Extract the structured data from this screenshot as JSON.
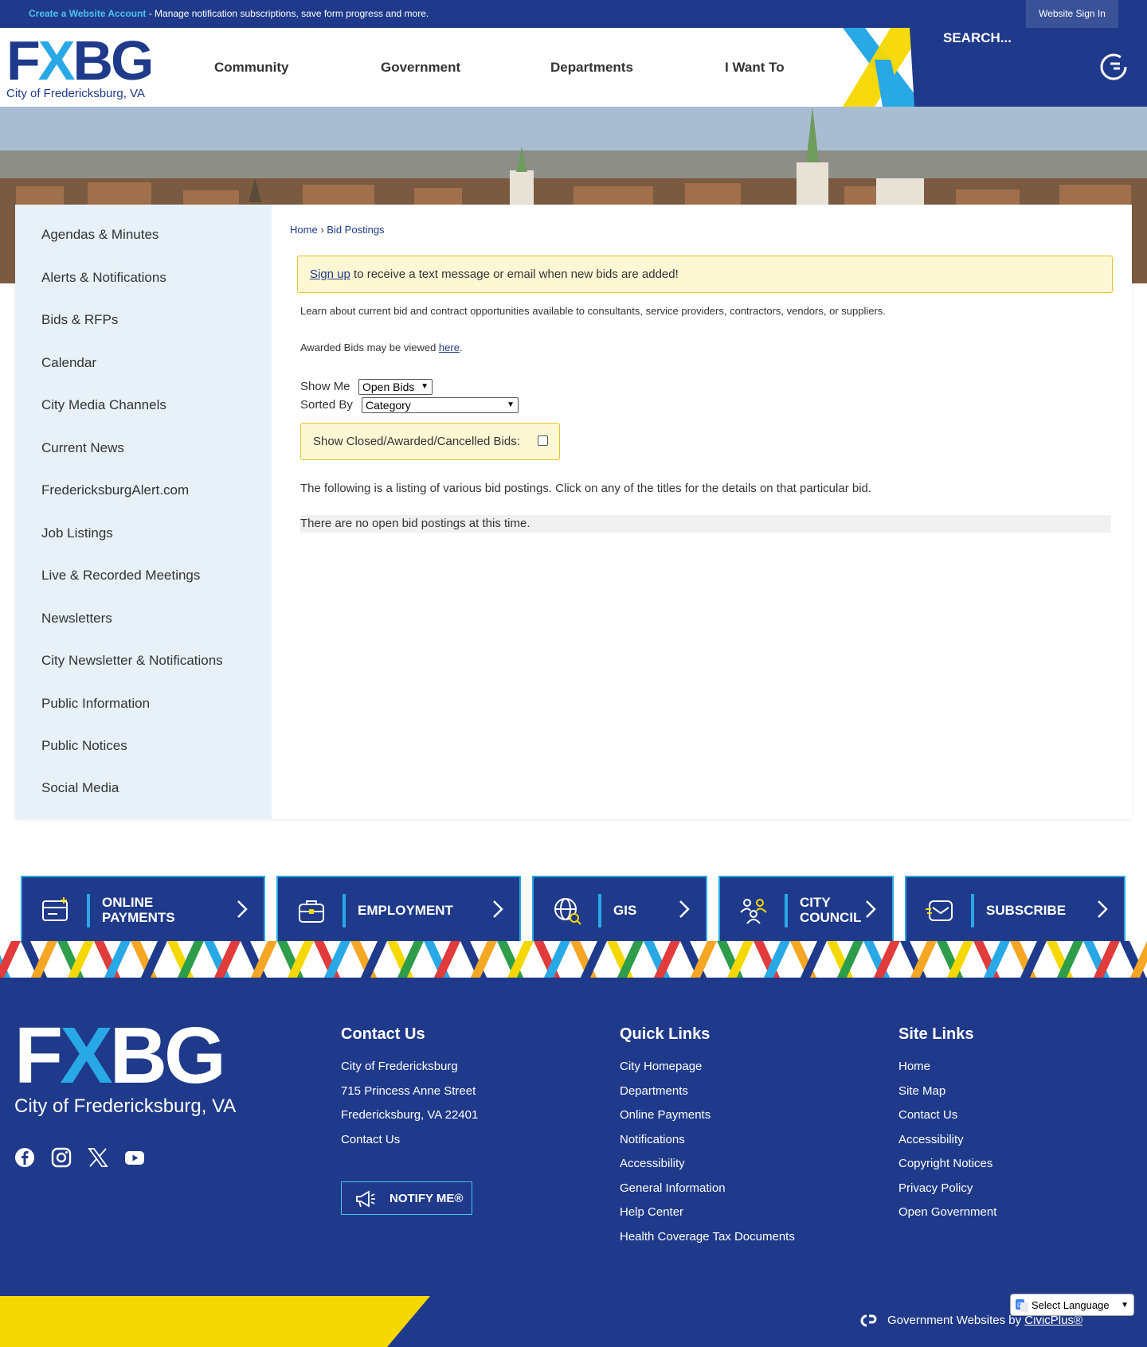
{
  "topbar": {
    "create_link": "Create a Website Account",
    "message": " - Manage notification subscriptions, save form progress and more.",
    "signin": "Website Sign In"
  },
  "header": {
    "logo_letters_a": "F",
    "logo_letters_x": "X",
    "logo_letters_b": "BG",
    "logo_city": "City of Fredericksburg, VA",
    "nav": [
      "Community",
      "Government",
      "Departments",
      "I Want To"
    ],
    "search_placeholder": "SEARCH..."
  },
  "sidebar": {
    "items": [
      "Agendas & Minutes",
      "Alerts & Notifications",
      "Bids & RFPs",
      "Calendar",
      "City Media Channels",
      "Current News",
      "FredericksburgAlert.com",
      "Job Listings",
      "Live & Recorded Meetings",
      "Newsletters",
      "City Newsletter & Notifications",
      "Public Information",
      "Public Notices",
      "Social Media"
    ]
  },
  "content": {
    "breadcrumb_home": "Home",
    "breadcrumb_sep": "›",
    "breadcrumb_current": "Bid Postings",
    "signup_link": "Sign up",
    "signup_text": " to receive a text message or email when new bids are added!",
    "intro": "Learn about current bid and contract opportunities available to consultants, service providers, contractors, vendors, or suppliers.",
    "awarded_text": "Awarded Bids may be viewed ",
    "awarded_link": "here",
    "awarded_end": ".",
    "show_me_label": "Show Me",
    "show_me_value": "Open Bids",
    "sorted_by_label": "Sorted By",
    "sorted_by_value": "Category",
    "show_closed_label": "Show Closed/Awarded/Cancelled Bids:",
    "listing_text": "The following is a listing of various bid postings. Click on any of the titles for the details on that particular bid.",
    "no_bids": "There are no open bid postings at this time."
  },
  "tiles": [
    {
      "line1": "ONLINE",
      "line2": "PAYMENTS",
      "icon": "payment-icon"
    },
    {
      "line1": "EMPLOYMENT",
      "line2": "",
      "icon": "briefcase-icon"
    },
    {
      "line1": "GIS",
      "line2": "",
      "icon": "globe-search-icon"
    },
    {
      "line1": "CITY",
      "line2": "COUNCIL",
      "icon": "people-icon"
    },
    {
      "line1": "SUBSCRIBE",
      "line2": "",
      "icon": "envelope-icon"
    }
  ],
  "footer": {
    "logo_letters_a": "F",
    "logo_letters_x": "X",
    "logo_letters_b": "BG",
    "logo_city": "City of Fredericksburg, VA",
    "contact": {
      "title": "Contact Us",
      "items": [
        "City of Fredericksburg",
        "715 Princess Anne Street",
        "Fredericksburg, VA 22401",
        "Contact Us"
      ]
    },
    "quick": {
      "title": "Quick Links",
      "items": [
        "City Homepage",
        "Departments",
        "Online Payments",
        "Notifications",
        "Accessibility",
        "General Information",
        "Help Center",
        "Health Coverage Tax Documents"
      ]
    },
    "site": {
      "title": "Site Links",
      "items": [
        "Home",
        "Site Map",
        "Contact Us",
        "Accessibility",
        "Copyright Notices",
        "Privacy Policy",
        "Open Government"
      ]
    },
    "notify": "NOTIFY ME®"
  },
  "bottom": {
    "gov_text": "Government Websites by ",
    "gov_link": "CivicPlus®",
    "language": "Select Language"
  },
  "colors": {
    "primary": "#1f3a8a",
    "accent_blue": "#29a8e6",
    "accent_yellow": "#f5d800",
    "notice_bg": "#fdf7d4",
    "sidebar_bg": "#e8f1f8"
  }
}
